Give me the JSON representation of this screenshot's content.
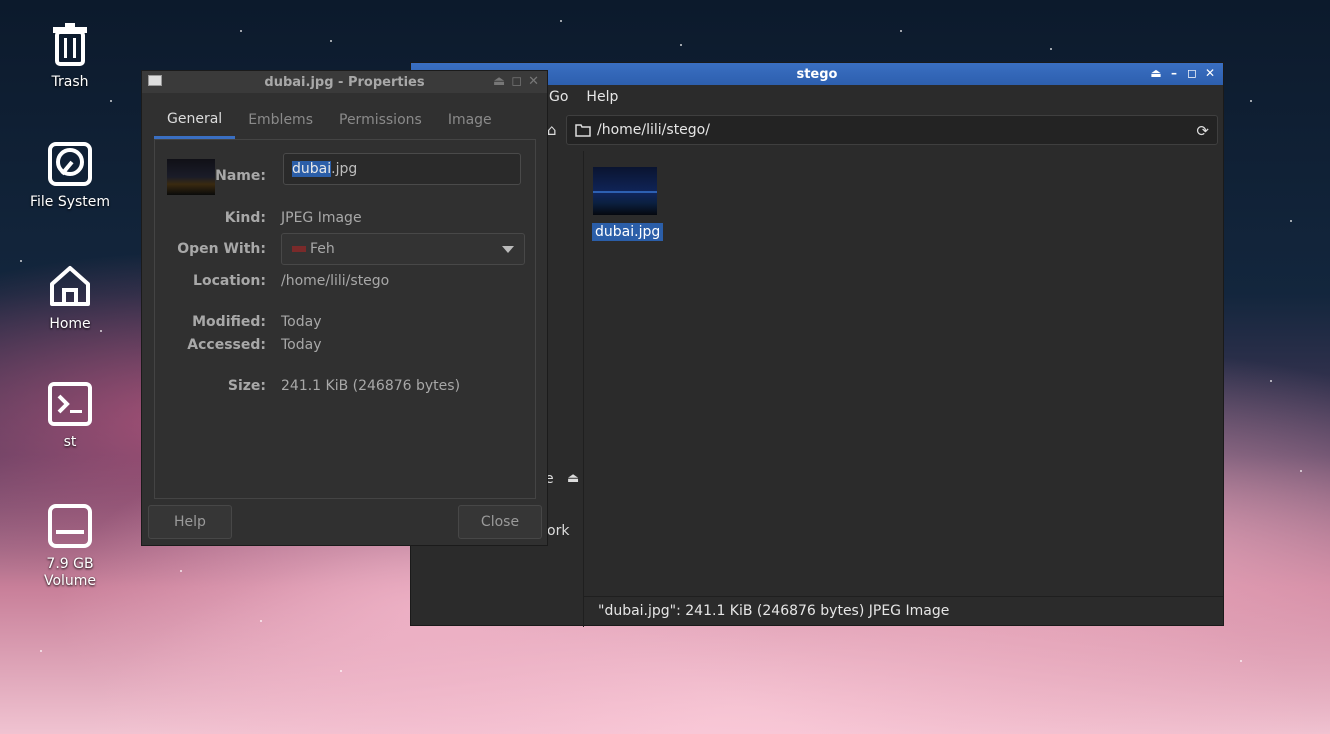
{
  "desktop": {
    "icons": [
      {
        "label": "Trash",
        "icon": "trash-icon"
      },
      {
        "label": "File System",
        "icon": "harddisk-icon"
      },
      {
        "label": "Home",
        "icon": "home-icon"
      },
      {
        "label": "st",
        "icon": "terminal-icon"
      },
      {
        "label": "7.9 GB\nVolume",
        "icon": "drive-icon"
      }
    ]
  },
  "thunar": {
    "title": "stego",
    "menu": [
      "Go",
      "Help"
    ],
    "location": "/home/lili/stego/",
    "sidepane_partial": [
      "e",
      "ork"
    ],
    "file": {
      "name": "dubai.jpg"
    },
    "status": "\"dubai.jpg\": 241.1 KiB (246876 bytes) JPEG Image"
  },
  "props": {
    "title": "dubai.jpg - Properties",
    "tabs": [
      "General",
      "Emblems",
      "Permissions",
      "Image"
    ],
    "active_tab": "General",
    "name_label": "Name:",
    "name_selected": "dubai",
    "name_rest": ".jpg",
    "kind_label": "Kind:",
    "kind": "JPEG Image",
    "openwith_label": "Open With:",
    "openwith": "Feh",
    "location_label": "Location:",
    "location": "/home/lili/stego",
    "modified_label": "Modified:",
    "modified": "Today",
    "accessed_label": "Accessed:",
    "accessed": "Today",
    "size_label": "Size:",
    "size": "241.1 KiB (246876 bytes)",
    "help_button": "Help",
    "close_button": "Close"
  },
  "colors": {
    "accent": "#2b5ea8",
    "titlebar_active": "#3a6fc2"
  }
}
